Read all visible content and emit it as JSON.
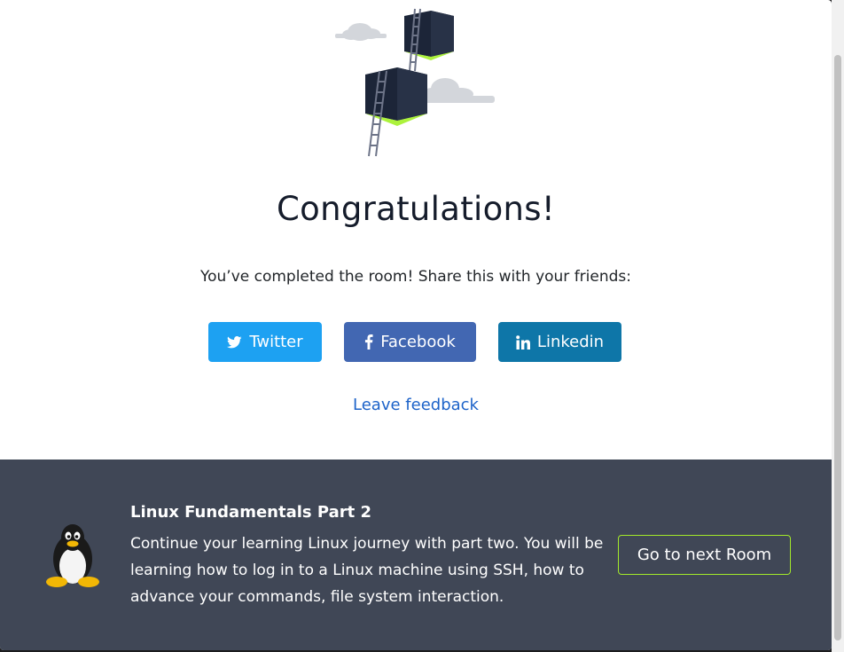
{
  "modal": {
    "title": "Congratulations!",
    "subtitle": "You’ve completed the room! Share this with your friends:",
    "share_buttons": [
      {
        "label": "Twitter",
        "icon": "twitter-icon",
        "color": "#1da1f2"
      },
      {
        "label": "Facebook",
        "icon": "facebook-icon",
        "color": "#4267b2"
      },
      {
        "label": "Linkedin",
        "icon": "linkedin-icon",
        "color": "#0e76a8"
      }
    ],
    "feedback_link": "Leave feedback"
  },
  "next_room": {
    "title": "Linux Fundamentals Part 2",
    "description": "Continue your learning Linux journey with part two. You will be learning how to log in to a Linux machine using SSH, how to advance your commands, file system interaction.",
    "button_label": "Go to next Room",
    "icon": "linux-penguin-icon"
  },
  "colors": {
    "footer_bg": "#404756",
    "accent_green": "#a3ea2a",
    "link_blue": "#1d63c9"
  }
}
